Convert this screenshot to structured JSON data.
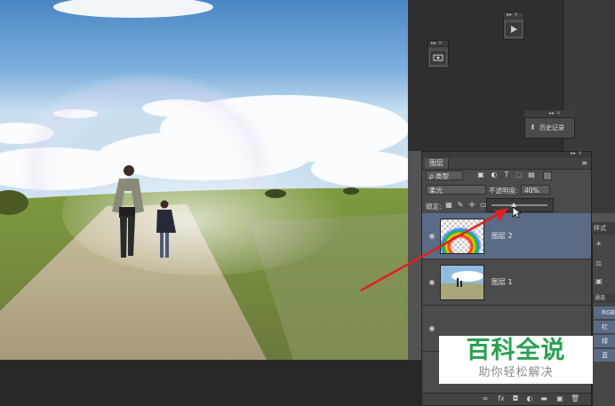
{
  "layers_panel": {
    "tab_label": "图层",
    "filter_kind": "ρ 类型",
    "blend_mode": "柔光",
    "opacity_label": "不透明度:",
    "opacity_value": "40%",
    "opacity_slider": 0.4,
    "lock_label": "锁定:",
    "layers": [
      {
        "name": "图层 2",
        "active": true
      },
      {
        "name": "图层 1",
        "active": false
      },
      {
        "name": "",
        "active": false
      }
    ]
  },
  "history_panel": {
    "label": "历史记录"
  },
  "side_panel": {
    "style_tab": "样式",
    "channels": [
      "RGB",
      "红",
      "绿",
      "蓝"
    ],
    "tab_label": "通道"
  },
  "watermark": {
    "title": "百科全说",
    "subtitle": "助你轻松解决"
  },
  "colors": {
    "accent_select": "#5a6b85",
    "watermark_green": "#27a150",
    "arrow": "#e02020"
  }
}
